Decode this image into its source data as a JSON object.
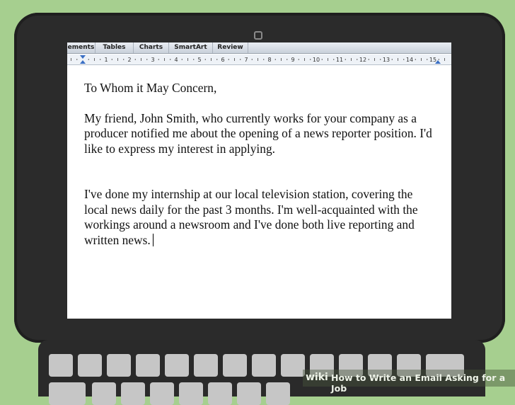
{
  "ribbon": {
    "tabs": [
      "ements",
      "Tables",
      "Charts",
      "SmartArt",
      "Review"
    ]
  },
  "ruler": {
    "numbers": [
      "1",
      "2",
      "3",
      "4",
      "5",
      "6",
      "7",
      "8",
      "9",
      "10",
      "11",
      "12",
      "13",
      "14",
      "15"
    ]
  },
  "document": {
    "greeting": "To Whom it May Concern,",
    "paragraph1": "My friend, John Smith, who currently works for your company as a producer notified me about the opening of a news reporter position. I'd like to express my interest in applying.",
    "paragraph2": "I've done my internship at our local television station, covering the local news daily for the past 3 months. I'm well-acquainted with the workings around a newsroom and I've done both live reporting and written news."
  },
  "watermark": {
    "brand": "wiki",
    "text": "How to Write an Email Asking for a Job"
  },
  "colors": {
    "background": "#a6cf8f",
    "laptop": "#2b2b2b",
    "page": "#ffffff"
  }
}
